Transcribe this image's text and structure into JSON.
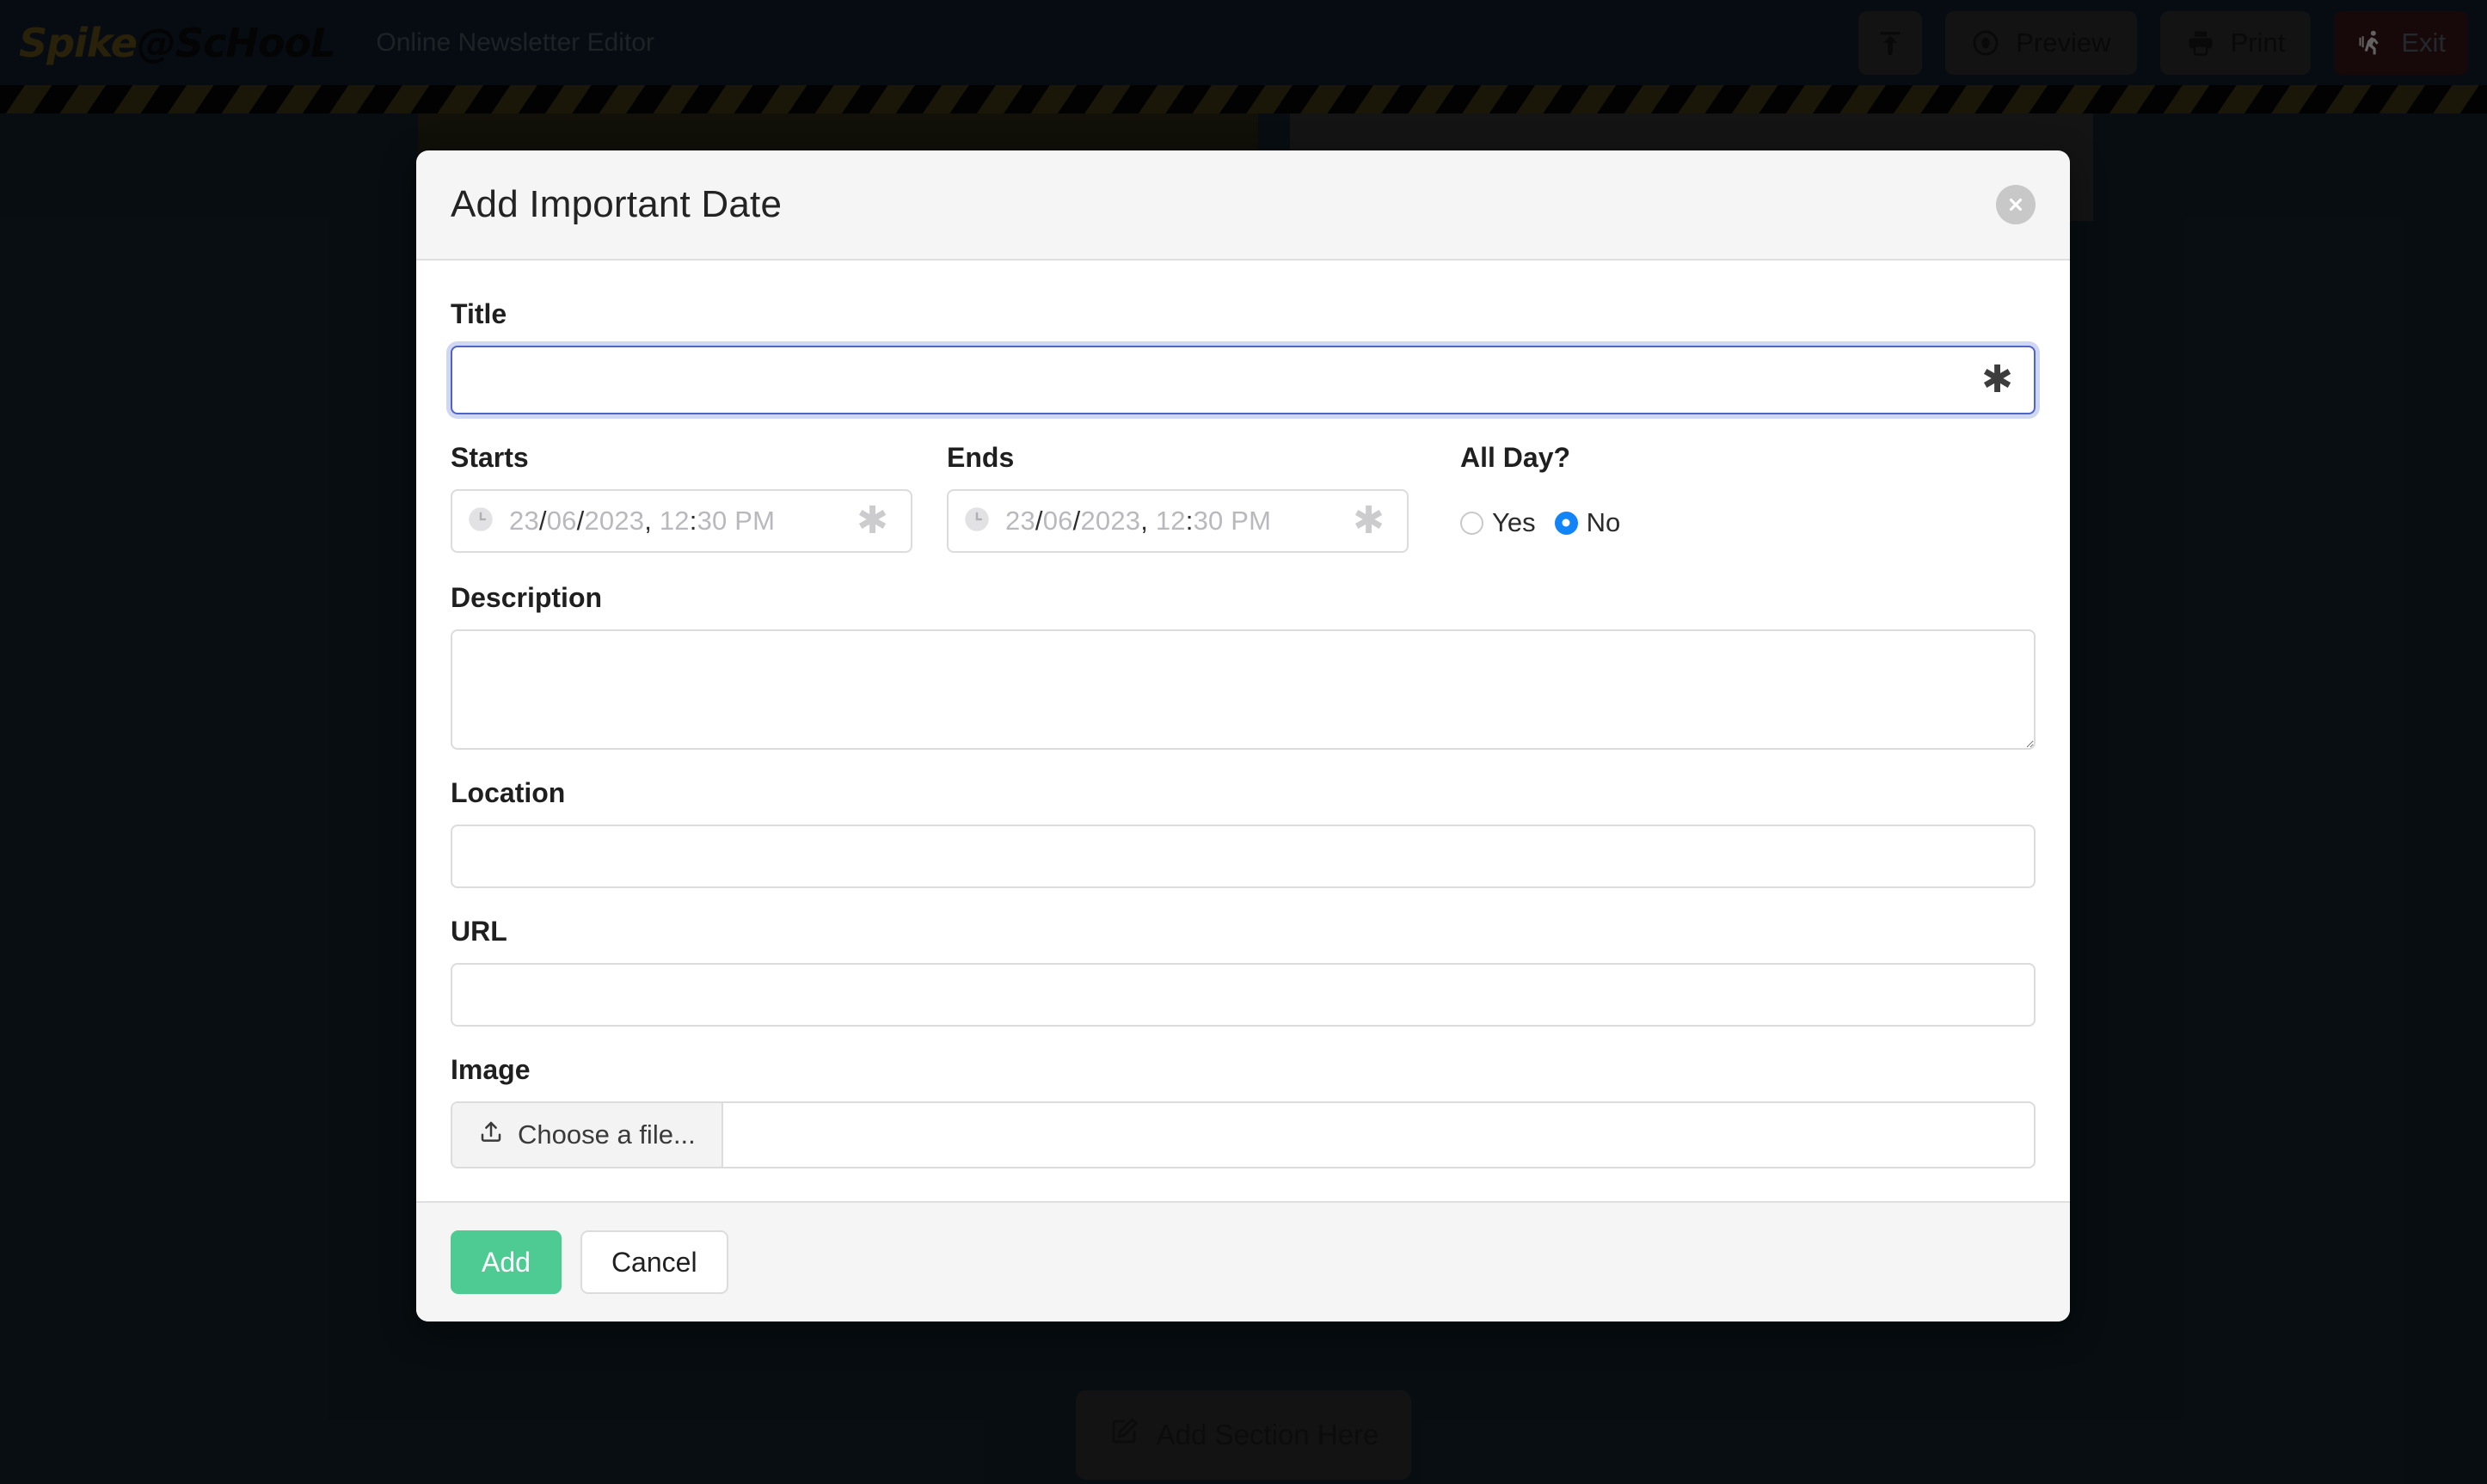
{
  "app": {
    "brand_spike": "Spike",
    "brand_at_school": "@ScHooL",
    "subtitle": "Online Newsletter Editor",
    "toolbar": {
      "publish_label": "",
      "preview_label": "Preview",
      "print_label": "Print",
      "exit_label": "Exit",
      "icons": {
        "publish": "upload-icon",
        "preview": "eye-icon",
        "print": "printer-icon",
        "exit": "running-person-icon"
      }
    },
    "canvas": {
      "add_section_label": "Add Section Here",
      "add_section_icon": "edit-square-icon"
    }
  },
  "modal": {
    "title": "Add Important Date",
    "close_icon": "close-icon",
    "fields": {
      "title": {
        "label": "Title",
        "value": "",
        "placeholder": "",
        "required_marker": "✱",
        "focused": true
      },
      "starts": {
        "label": "Starts",
        "value": "",
        "placeholder_day": "23",
        "placeholder_month": "06",
        "placeholder_year": "2023",
        "placeholder_hour": "12",
        "placeholder_minute": "30",
        "placeholder_meridiem": "PM",
        "placeholder_full": "23/06/2023, 12:30 PM",
        "icon": "clock-icon",
        "required_marker": "✱"
      },
      "ends": {
        "label": "Ends",
        "value": "",
        "placeholder_day": "23",
        "placeholder_month": "06",
        "placeholder_year": "2023",
        "placeholder_hour": "12",
        "placeholder_minute": "30",
        "placeholder_meridiem": "PM",
        "placeholder_full": "23/06/2023, 12:30 PM",
        "icon": "clock-icon",
        "required_marker": "✱"
      },
      "all_day": {
        "label": "All Day?",
        "options": [
          "Yes",
          "No"
        ],
        "selected": "No"
      },
      "description": {
        "label": "Description",
        "value": "",
        "placeholder": ""
      },
      "location": {
        "label": "Location",
        "value": "",
        "placeholder": ""
      },
      "url": {
        "label": "URL",
        "value": "",
        "placeholder": ""
      },
      "image": {
        "label": "Image",
        "choose_label": "Choose a file...",
        "choose_icon": "upload-file-icon",
        "file_name": ""
      }
    },
    "footer": {
      "add_label": "Add",
      "cancel_label": "Cancel"
    }
  },
  "colors": {
    "accent_green": "#4ecb92",
    "focus_blue": "#4f63c9",
    "radio_blue": "#1284f7",
    "topbar_bg": "#0e1c26",
    "canvas_bg": "#111e27",
    "modal_bg": "#ffffff",
    "modal_chrome": "#f5f5f6",
    "exit_bg": "#341414"
  }
}
